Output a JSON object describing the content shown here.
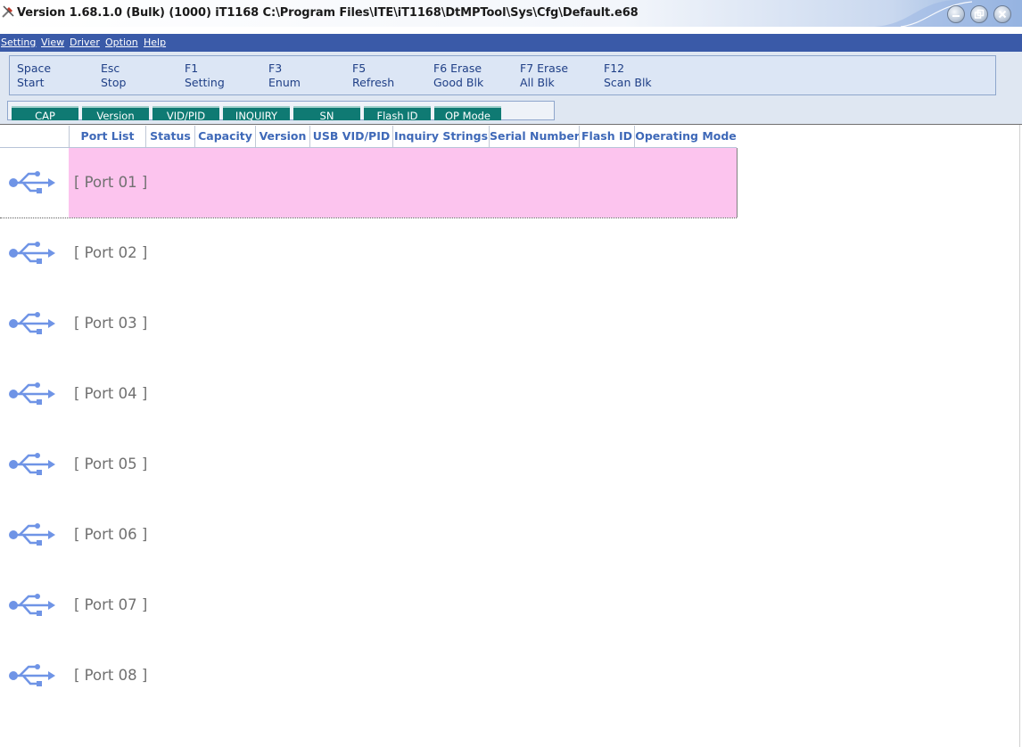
{
  "window": {
    "title": "Version 1.68.1.0 (Bulk) (1000) iT1168 C:\\Program Files\\ITE\\iT1168\\DtMPTool\\Sys\\Cfg\\Default.e68",
    "icon": "tools-icon",
    "controls": [
      "minimize-icon",
      "restore-icon",
      "close-icon"
    ]
  },
  "menu": [
    {
      "label": "Setting"
    },
    {
      "label": "View"
    },
    {
      "label": "Driver"
    },
    {
      "label": "Option"
    },
    {
      "label": "Help"
    }
  ],
  "shortcuts": [
    {
      "key": "Space",
      "action": "Start"
    },
    {
      "key": "Esc",
      "action": "Stop"
    },
    {
      "key": "F1",
      "action": "Setting"
    },
    {
      "key": "F3",
      "action": "Enum"
    },
    {
      "key": "F5",
      "action": "Refresh"
    },
    {
      "key": "F6 Erase",
      "action": "Good Blk"
    },
    {
      "key": "F7 Erase",
      "action": "All Blk"
    },
    {
      "key": "F12",
      "action": "Scan Blk"
    }
  ],
  "view_tabs": [
    {
      "label": "CAP"
    },
    {
      "label": "Version"
    },
    {
      "label": "VID/PID"
    },
    {
      "label": "INQUIRY"
    },
    {
      "label": "SN"
    },
    {
      "label": "Flash ID"
    },
    {
      "label": "OP Mode"
    }
  ],
  "columns": [
    {
      "label": "Port List"
    },
    {
      "label": "Status"
    },
    {
      "label": "Capacity"
    },
    {
      "label": "Version"
    },
    {
      "label": "USB VID/PID"
    },
    {
      "label": "Inquiry Strings"
    },
    {
      "label": "Serial Number"
    },
    {
      "label": "Flash ID"
    },
    {
      "label": "Operating Mode"
    }
  ],
  "ports": [
    {
      "label": "[ Port 01 ]",
      "selected": true,
      "icon": "usb-icon"
    },
    {
      "label": "[ Port 02 ]",
      "selected": false,
      "icon": "usb-icon"
    },
    {
      "label": "[ Port 03 ]",
      "selected": false,
      "icon": "usb-icon"
    },
    {
      "label": "[ Port 04 ]",
      "selected": false,
      "icon": "usb-icon"
    },
    {
      "label": "[ Port 05 ]",
      "selected": false,
      "icon": "usb-icon"
    },
    {
      "label": "[ Port 06 ]",
      "selected": false,
      "icon": "usb-icon"
    },
    {
      "label": "[ Port 07 ]",
      "selected": false,
      "icon": "usb-icon"
    },
    {
      "label": "[ Port 08 ]",
      "selected": false,
      "icon": "usb-icon"
    }
  ],
  "colors": {
    "menubar": "#3a5aa8",
    "tab_button": "#0f7a73",
    "selected_row": "#fcc4ee",
    "header_text": "#3f69b8",
    "usb_icon": "#6f94e6"
  }
}
